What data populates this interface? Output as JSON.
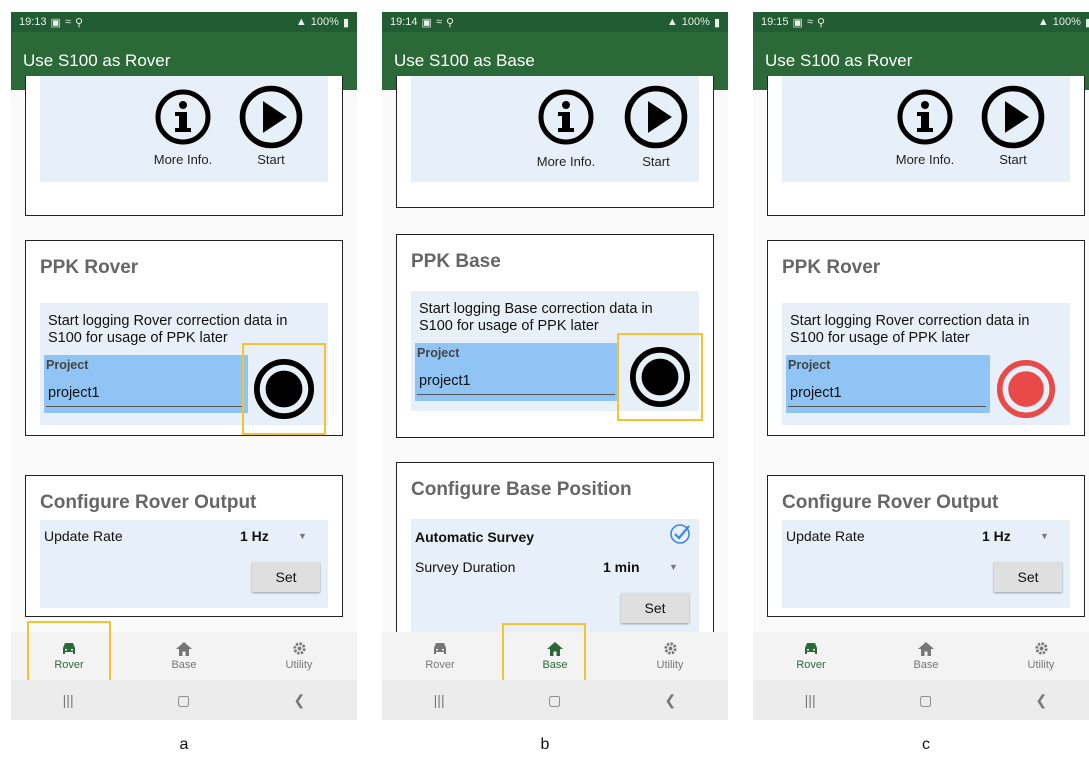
{
  "colors": {
    "appbar": "#2b6a38",
    "statusbar": "#225c32",
    "highlight": "#f4c430",
    "record_active": "#e84a4a",
    "panel": "#e7f0f8",
    "project_field": "#90c4f4"
  },
  "nav": {
    "rover": "Rover",
    "base": "Base",
    "utility": "Utility"
  },
  "common": {
    "more_info": "More Info.",
    "start": "Start",
    "project_label": "Project",
    "project_value": "project1",
    "set": "Set"
  },
  "screens": [
    {
      "status_time": "19:13",
      "status_right": "100%",
      "title": "Use S100 as Rover",
      "ppk_title": "PPK Rover",
      "ppk_desc": "Start logging Rover correction data in S100 for usage of PPK later",
      "config_title": "Configure Rover Output",
      "row1_label": "Update Rate",
      "row1_value": "1 Hz",
      "active_tab": "Rover",
      "record_state": "idle",
      "caption": "a"
    },
    {
      "status_time": "19:14",
      "status_right": "100%",
      "title": "Use S100 as Base",
      "ppk_title": "PPK Base",
      "ppk_desc": "Start logging Base correction data in S100 for usage of PPK later",
      "config_title": "Configure Base Position",
      "section_label": "Automatic Survey",
      "row1_label": "Survey Duration",
      "row1_value": "1 min",
      "active_tab": "Base",
      "record_state": "idle",
      "caption": "b"
    },
    {
      "status_time": "19:15",
      "status_right": "100%",
      "title": "Use S100 as Rover",
      "ppk_title": "PPK Rover",
      "ppk_desc": "Start logging Rover correction data in S100 for usage of PPK later",
      "config_title": "Configure Rover Output",
      "row1_label": "Update Rate",
      "row1_value": "1 Hz",
      "active_tab": "Rover",
      "record_state": "recording",
      "caption": "c"
    }
  ]
}
